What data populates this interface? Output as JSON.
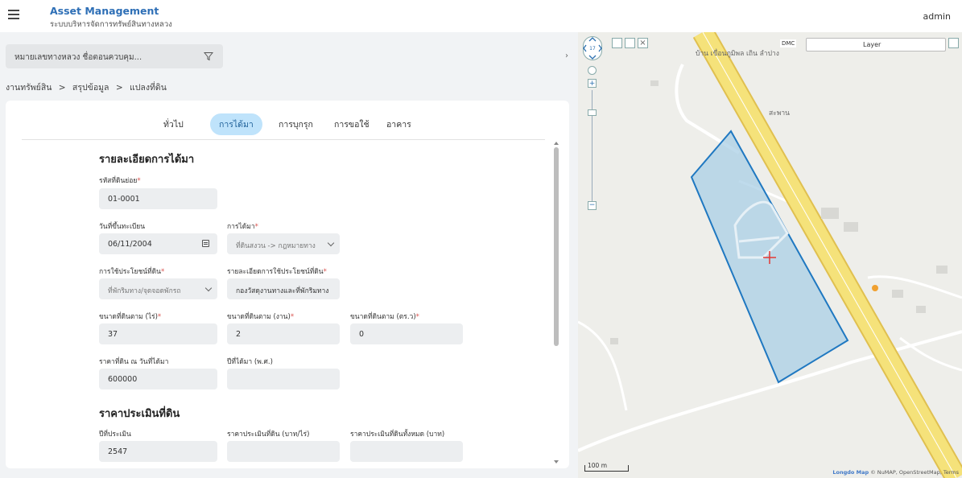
{
  "header": {
    "app_title": "Asset Management",
    "app_subtitle": "ระบบบริหารจัดการทรัพย์สินทางหลวง",
    "user": "admin"
  },
  "filter": {
    "placeholder": "หมายเลขทางหลวง ชื่อตอนควบคุม..."
  },
  "breadcrumb": [
    "งานทรัพย์สิน",
    "สรุปข้อมูล",
    "แปลงที่ดิน"
  ],
  "breadcrumb_separator": ">",
  "tabs": [
    {
      "label": "ทั่วไป"
    },
    {
      "label": "การได้มา",
      "active": true
    },
    {
      "label": "การบุกรุก"
    },
    {
      "label": "การขอใช้"
    },
    {
      "label": "อาคาร"
    }
  ],
  "acquisition": {
    "title": "รายละเอียดการได้มา",
    "sub_code_label": "รหัสที่ดินย่อย",
    "sub_code": "01-0001",
    "reg_date_label": "วันที่ขึ้นทะเบียน",
    "reg_date": "06/11/2004",
    "acq_method_label": "การได้มา",
    "acq_method": "ที่ดินสงวน -> กฎหมายทาง",
    "usage_label": "การใช้ประโยชน์ที่ดิน",
    "usage": "ที่พักริมทาง/จุดจอดพักรถ",
    "usage_detail_label": "รายละเอียดการใช้ประโยชน์ที่ดิน",
    "usage_detail": "กองวัสดุงานทางและที่พักริมทาง",
    "size_rai_label": "ขนาดที่ดินตาม (ไร่)",
    "size_rai": "37",
    "size_ngan_label": "ขนาดที่ดินตาม (งาน)",
    "size_ngan": "2",
    "size_wa_label": "ขนาดที่ดินตาม (ตร.ว)",
    "size_wa": "0",
    "price_label": "ราคาที่ดิน ณ วันที่ได้มา",
    "price": "600000",
    "acq_year_label": "ปีที่ได้มา (พ.ศ.)",
    "acq_year": ""
  },
  "appraisal": {
    "title": "ราคาประเมินที่ดิน",
    "year_label": "ปีที่ประเมิน",
    "year": "2547",
    "per_rai_label": "ราคาประเมินที่ดิน (บาท/ไร่)",
    "per_rai": "",
    "total_label": "ราคาประเมินที่ดินทั้งหมด (บาท)",
    "total": ""
  },
  "map": {
    "dmc": "DMC",
    "layer": "Layer",
    "place_1": "บ้าน เขื่อนภูมิพล เถิน ลำปาง",
    "place_2": "สะพาน",
    "scale": "100 m",
    "attribution_logo": "Longdo Map",
    "attribution": "© NuMAP, OpenStreetMap, Terms",
    "parcel_fill": "#a9cfe6",
    "parcel_stroke": "#1f78c1",
    "road_color": "#f2d94e"
  }
}
